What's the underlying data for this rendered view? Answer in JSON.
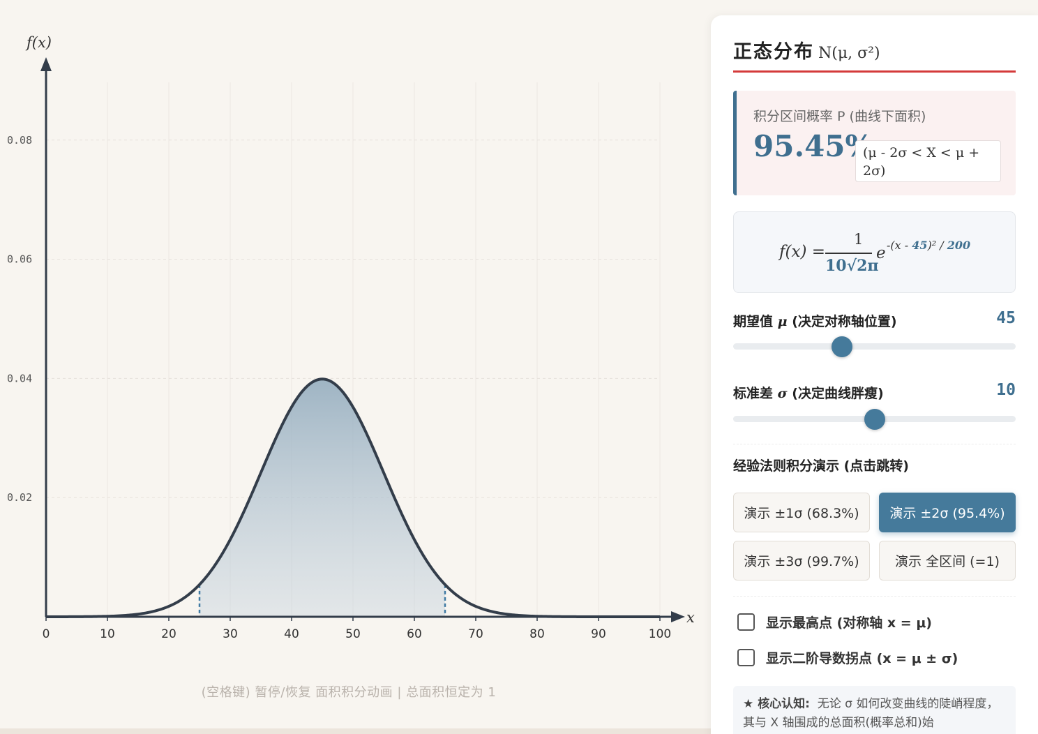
{
  "chart_data": {
    "type": "area",
    "distribution": "normal",
    "mu": 45,
    "sigma": 10,
    "xlabel": "x",
    "ylabel": "f(x)",
    "xlim": [
      0,
      100
    ],
    "ylim": [
      0,
      0.09
    ],
    "x_ticks": [
      "0",
      "10",
      "20",
      "30",
      "40",
      "50",
      "60",
      "70",
      "80",
      "90",
      "100"
    ],
    "y_ticks": [
      "0.02",
      "0.04",
      "0.06",
      "0.08"
    ],
    "shaded_interval": [
      25,
      65
    ],
    "peak_value": 0.0399,
    "grid": true,
    "curve_color": "#333d4a",
    "fill_color": "#8fa9bc",
    "marker_color": "#3f7aa3"
  },
  "hint": "(空格键) 暂停/恢复 面积积分动画 | 总面积恒定为 1",
  "panel": {
    "title": "正态分布",
    "title_notation": "N(μ, σ²)",
    "accent_color": "#d43a3a",
    "probability": {
      "label": "积分区间概率 P (曲线下面积)",
      "value": "95.45%",
      "range": "(μ - 2σ < X < μ + 2σ)"
    },
    "formula": {
      "lhs": "f(x) =",
      "numerator": "1",
      "denominator": "10√2π",
      "base": "e",
      "exp_prefix": "-(x - ",
      "exp_mu": "45",
      "exp_mid": ")² / ",
      "exp_var": "200"
    },
    "mu_slider": {
      "label": "期望值",
      "symbol": "μ",
      "desc": "(决定对称轴位置)",
      "value": "45",
      "fraction": 0.385
    },
    "sigma_slider": {
      "label": "标准差",
      "symbol": "σ",
      "desc": "(决定曲线胖瘦)",
      "value": "10",
      "fraction": 0.5
    },
    "demo_title": "经验法则积分演示 (点击跳转)",
    "demo_buttons": [
      "演示 ±1σ (68.3%)",
      "演示 ±2σ (95.4%)",
      "演示 ±3σ (99.7%)",
      "演示 全区间 (=1)"
    ],
    "active_demo": 1,
    "checkboxes": [
      "显示最高点 (对称轴 x = μ)",
      "显示二阶导数拐点 (x = μ ± σ)"
    ],
    "insight_title": "★ 核心认知:",
    "insight_text": "无论 σ 如何改变曲线的陡峭程度，其与 X 轴围成的总面积(概率总和)始"
  }
}
